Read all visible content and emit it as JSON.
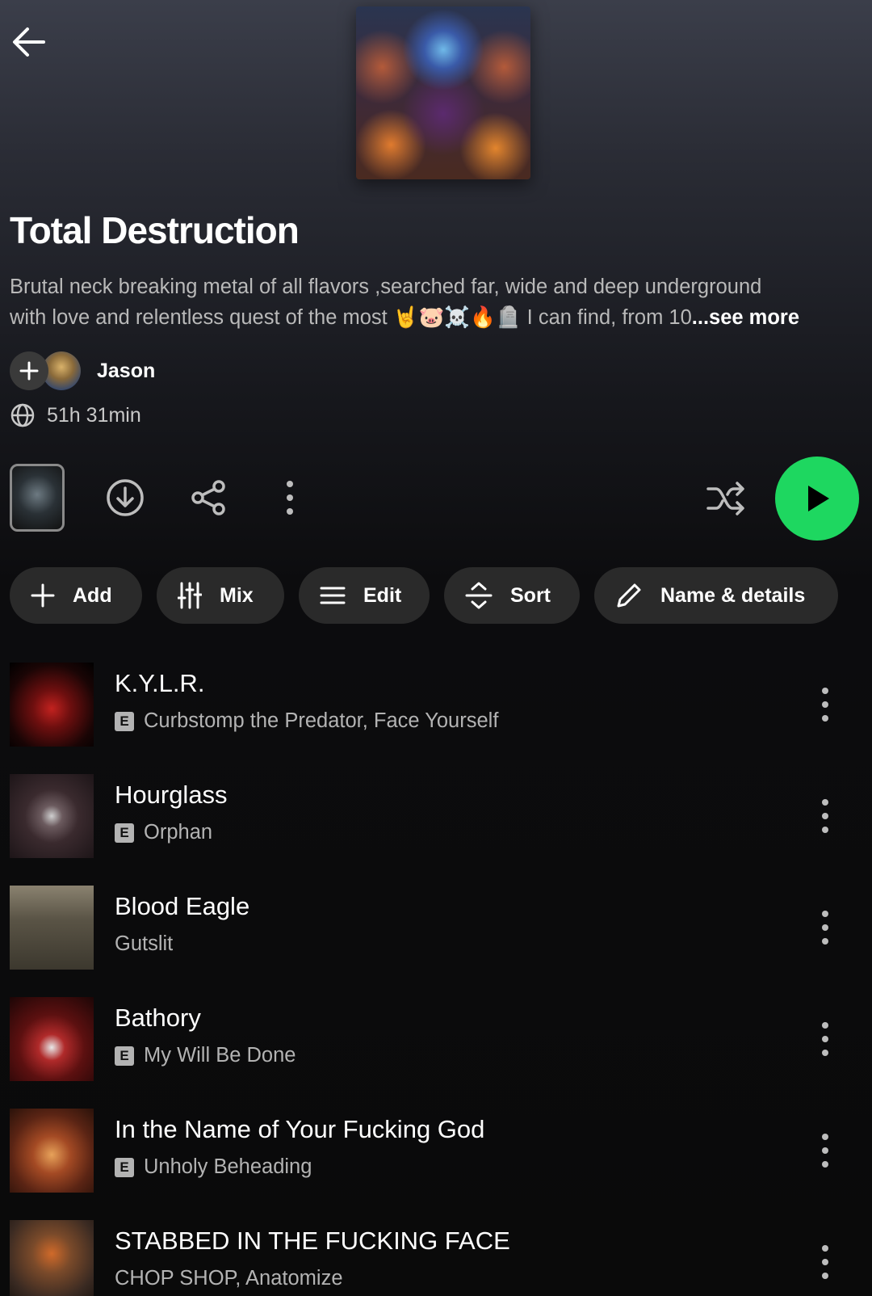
{
  "header": {
    "back_icon": "arrow-left-icon"
  },
  "playlist": {
    "title": "Total Destruction",
    "description_line1": "Brutal neck breaking metal of all flavors ,searched far, wide and deep underground",
    "description_line2": "with love and relentless quest of the most 🤘🐷☠️🔥🪦 I can find, from 10",
    "see_more": "...see more",
    "owner": "Jason",
    "duration": "51h 31min"
  },
  "actions": {
    "download_icon": "download-icon",
    "share_icon": "share-icon",
    "more_icon": "more-vertical-icon",
    "shuffle_icon": "shuffle-icon",
    "play_icon": "play-icon",
    "accent_color": "#1ed760"
  },
  "chips": [
    {
      "label": "Add",
      "icon": "plus-icon"
    },
    {
      "label": "Mix",
      "icon": "sliders-icon"
    },
    {
      "label": "Edit",
      "icon": "menu-lines-icon"
    },
    {
      "label": "Sort",
      "icon": "sort-icon"
    },
    {
      "label": "Name & details",
      "icon": "pencil-icon"
    }
  ],
  "tracks": [
    {
      "title": "K.Y.L.R.",
      "explicit": "E",
      "artist": "Curbstomp the Predator, Face Yourself"
    },
    {
      "title": "Hourglass",
      "explicit": "E",
      "artist": "Orphan"
    },
    {
      "title": "Blood Eagle",
      "explicit": "",
      "artist": "Gutslit"
    },
    {
      "title": "Bathory",
      "explicit": "E",
      "artist": "My Will Be Done"
    },
    {
      "title": "In the Name of Your Fucking God",
      "explicit": "E",
      "artist": "Unholy Beheading"
    },
    {
      "title": "STABBED IN THE FUCKING FACE",
      "explicit": "",
      "artist": "CHOP SHOP, Anatomize"
    }
  ]
}
